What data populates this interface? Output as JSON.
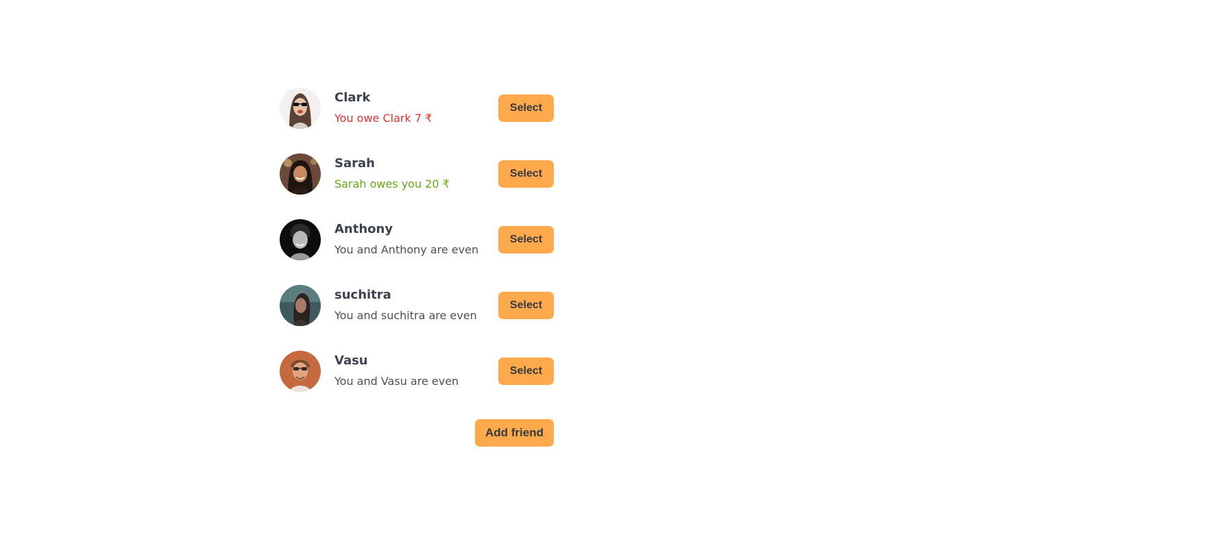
{
  "friends": [
    {
      "name": "Clark",
      "balance_text": "You owe Clark 7 ₹",
      "status": "owe",
      "select_label": "Select"
    },
    {
      "name": "Sarah",
      "balance_text": "Sarah owes you 20 ₹",
      "status": "owed",
      "select_label": "Select"
    },
    {
      "name": "Anthony",
      "balance_text": "You and Anthony are even",
      "status": "even",
      "select_label": "Select"
    },
    {
      "name": "suchitra",
      "balance_text": "You and suchitra are even",
      "status": "even",
      "select_label": "Select"
    },
    {
      "name": "Vasu",
      "balance_text": "You and Vasu are even",
      "status": "even",
      "select_label": "Select"
    }
  ],
  "add_friend_label": "Add friend",
  "colors": {
    "button_bg": "#ffa94d",
    "owe": "#e03131",
    "owed": "#66a80f",
    "even": "#495057"
  }
}
